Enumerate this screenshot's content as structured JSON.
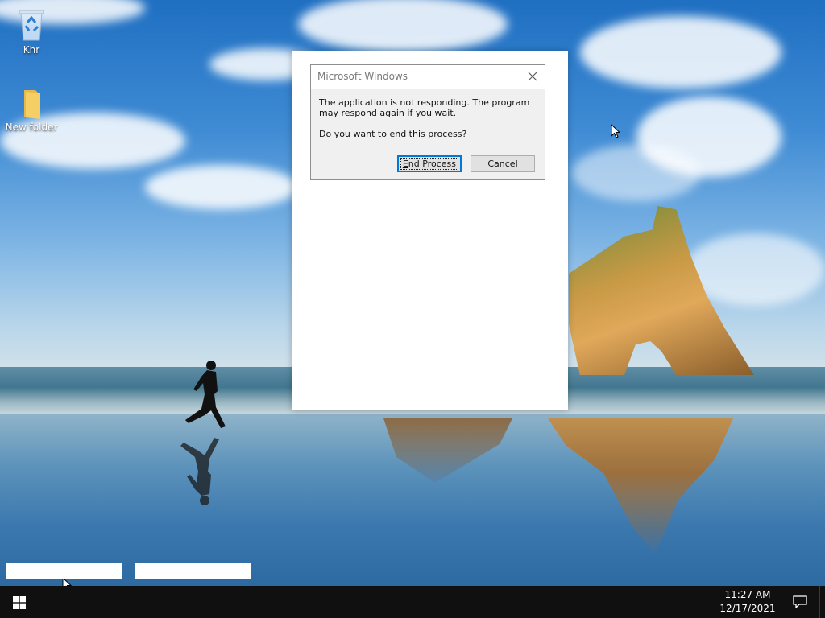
{
  "desktop": {
    "icons": [
      {
        "label": "Khr",
        "icon": "recycle-bin-icon"
      },
      {
        "label": "New folder",
        "icon": "folder-icon"
      }
    ]
  },
  "dialog": {
    "title": "Microsoft Windows",
    "message": "The application is not responding. The program may respond again if you wait.",
    "question": "Do you want to end this process?",
    "buttons": {
      "end_process": "End Process",
      "end_process_mnemonic": "E",
      "end_process_rest": "nd Process",
      "cancel": "Cancel"
    },
    "close_icon": "close-icon"
  },
  "taskbar": {
    "time": "11:27 AM",
    "date": "12/17/2021",
    "start_icon": "windows-logo-icon",
    "notification_icon": "action-center-icon"
  },
  "colors": {
    "accent": "#0078d7",
    "taskbar": "#101010",
    "dialog_bg": "#f0f0f0"
  }
}
